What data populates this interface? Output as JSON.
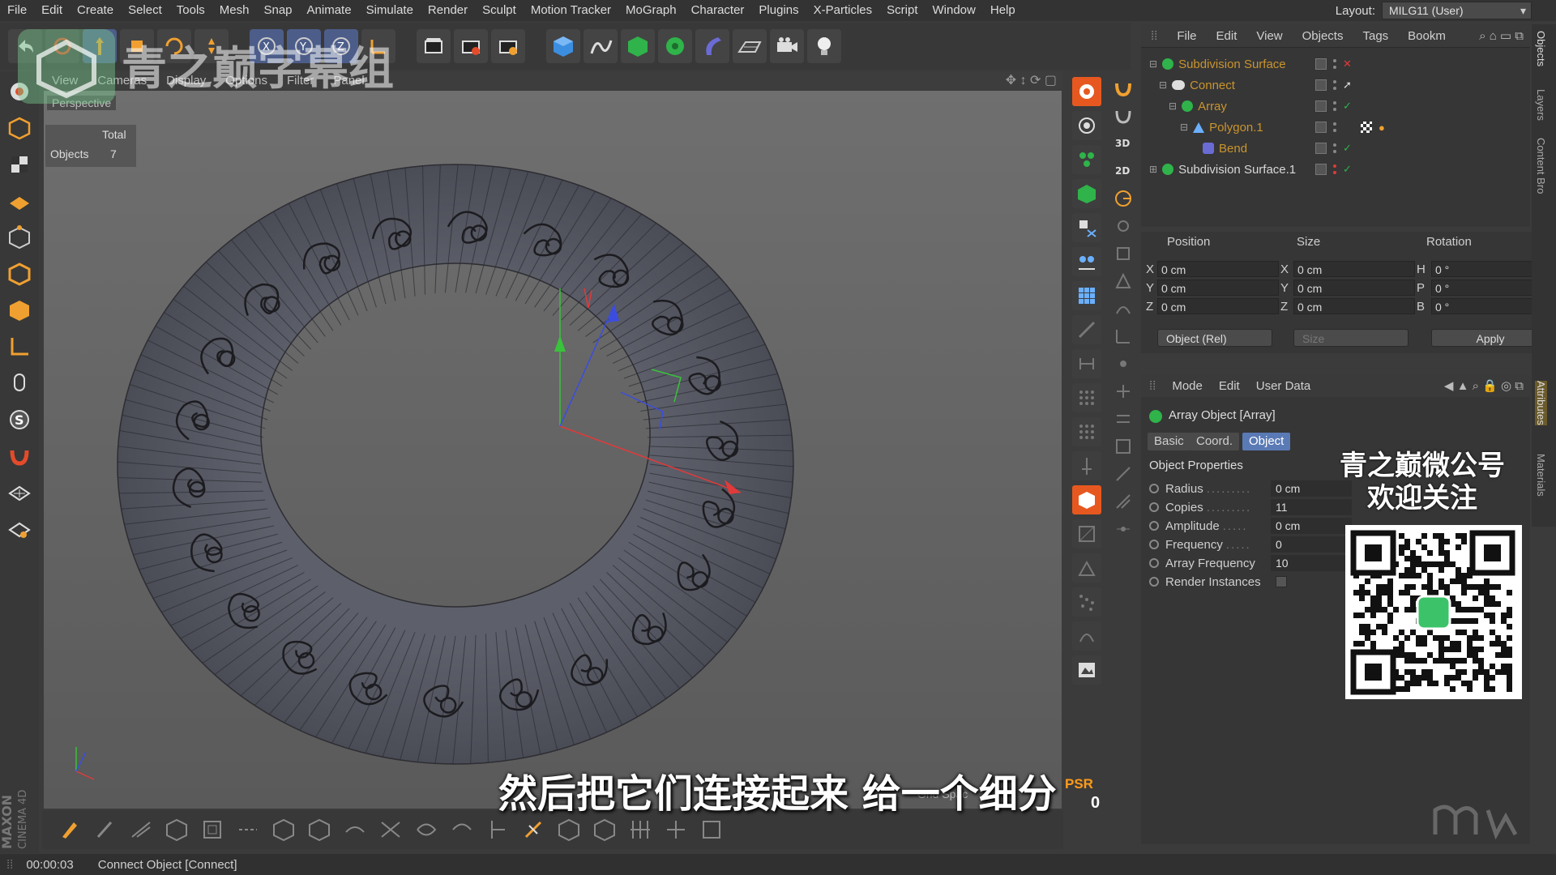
{
  "menu": [
    "File",
    "Edit",
    "Create",
    "Select",
    "Tools",
    "Mesh",
    "Snap",
    "Animate",
    "Simulate",
    "Render",
    "Sculpt",
    "Motion Tracker",
    "MoGraph",
    "Character",
    "Plugins",
    "X-Particles",
    "Script",
    "Window",
    "Help"
  ],
  "layout": {
    "label": "Layout:",
    "value": "MILG11 (User)"
  },
  "viewport": {
    "menu": [
      "View",
      "Cameras",
      "Display",
      "Options",
      "Filter",
      "Panel"
    ],
    "label": "Perspective",
    "stats": {
      "header": "Total",
      "label": "Objects",
      "value": "7"
    },
    "grid_label": "Grid Spac"
  },
  "object_manager": {
    "menu": [
      "File",
      "Edit",
      "View",
      "Objects",
      "Tags",
      "Bookm"
    ],
    "rows": [
      {
        "name": "Subdivision Surface",
        "color": "orange"
      },
      {
        "name": "Connect",
        "color": "orange"
      },
      {
        "name": "Array",
        "color": "orange"
      },
      {
        "name": "Polygon.1",
        "color": "orange"
      },
      {
        "name": "Bend",
        "color": "orange"
      },
      {
        "name": "Subdivision Surface.1",
        "color": "white"
      }
    ]
  },
  "coords": {
    "headers": {
      "position": "Position",
      "size": "Size",
      "rotation": "Rotation"
    },
    "position": [
      {
        "axis": "X",
        "value": "0 cm"
      },
      {
        "axis": "Y",
        "value": "0 cm"
      },
      {
        "axis": "Z",
        "value": "0 cm"
      }
    ],
    "size": [
      {
        "axis": "X",
        "value": "0 cm"
      },
      {
        "axis": "Y",
        "value": "0 cm"
      },
      {
        "axis": "Z",
        "value": "0 cm"
      }
    ],
    "rotation": [
      {
        "axis": "H",
        "value": "0 °"
      },
      {
        "axis": "P",
        "value": "0 °"
      },
      {
        "axis": "B",
        "value": "0 °"
      }
    ],
    "mode_select": "Object (Rel)",
    "size_select": "Size",
    "apply": "Apply"
  },
  "attributes": {
    "menu": [
      "Mode",
      "Edit",
      "User Data"
    ],
    "title": "Array Object [Array]",
    "tabs": [
      "Basic",
      "Coord.",
      "Object"
    ],
    "active_tab": "Object",
    "section": "Object Properties",
    "props": [
      {
        "label": "Radius",
        "value": "0 cm"
      },
      {
        "label": "Copies",
        "value": "11"
      },
      {
        "label": "Amplitude",
        "value": "0 cm"
      },
      {
        "label": "Frequency",
        "value": "0"
      },
      {
        "label": "Array Frequency",
        "value": "10"
      },
      {
        "label": "Render Instances",
        "value": ""
      }
    ]
  },
  "side_tabs": [
    "Objects",
    "Layers",
    "Content Bro",
    "Attributes",
    "Materials"
  ],
  "psr": {
    "label": "PSR",
    "value": "0"
  },
  "status": {
    "time": "00:00:03",
    "text": "Connect Object [Connect]"
  },
  "overlay": {
    "subtitle": "然后把它们连接起来 给一个细分",
    "watermark": "青之巅字幕组",
    "promo_line1": "青之巅微公号",
    "promo_line2": "欢迎关注"
  },
  "colors": {
    "accent_orange": "#ff9b1a",
    "selected_tab": "#5a7ab5",
    "object_orange": "#c9942e"
  }
}
